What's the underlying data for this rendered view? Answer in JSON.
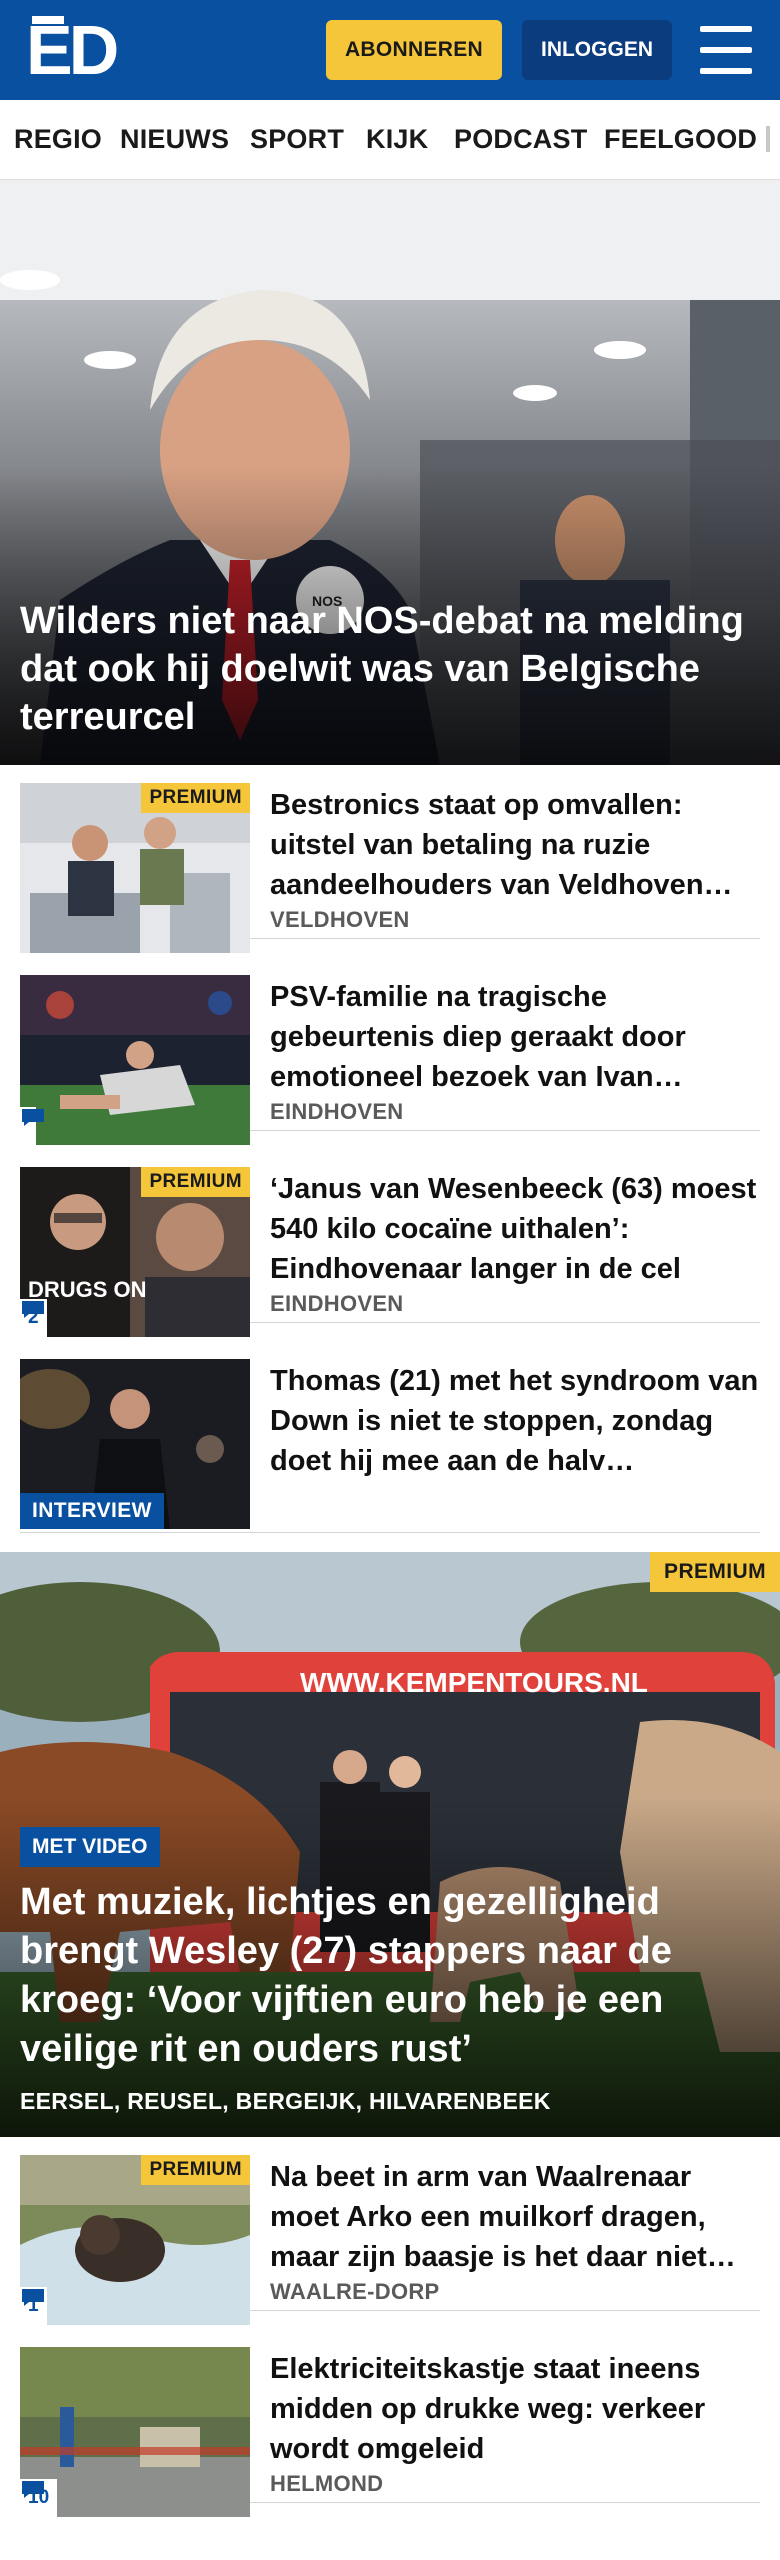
{
  "header": {
    "logo_text": "ED",
    "subscribe_label": "ABONNEREN",
    "login_label": "INLOGGEN",
    "menu_icon": "hamburger-menu-icon",
    "brand_color": "#0a50a0",
    "accent_color": "#f6c63a"
  },
  "nav": {
    "items": [
      "REGIO",
      "NIEUWS",
      "SPORT",
      "KIJK",
      "PODCAST",
      "FEELGOOD"
    ]
  },
  "hero": {
    "title": "Wilders niet naar NOS-debat na melding dat ook hij doelwit was van Belgische terreurcel"
  },
  "articles": [
    {
      "title": "Bestronics staat op omvallen: uitstel van betaling na ruzie aandeelhouders van Veldhoven…",
      "location": "VELDHOVEN",
      "badge": "PREMIUM"
    },
    {
      "title": "PSV-familie na tragische gebeurtenis diep geraakt door emotioneel bezoek van Ivan…",
      "location": "EINDHOVEN",
      "comment_count": ""
    },
    {
      "title": "‘Janus van Wesenbeeck (63) moest 540 kilo cocaïne uithalen’: Eindhovenaar langer in de cel",
      "location": "EINDHOVEN",
      "badge": "PREMIUM",
      "comment_count": "2",
      "thumb_text": "DRUGS ON"
    },
    {
      "title": "Thomas (21) met het syndroom van Down is niet te stoppen, zondag doet hij mee aan de halv…",
      "label": "INTERVIEW"
    }
  ],
  "feature": {
    "badge": "PREMIUM",
    "video_label": "MET VIDEO",
    "title": "Met muziek, lichtjes en gezelligheid brengt Wesley (27) stappers naar de kroeg: ‘Voor vijftien euro heb je een veilige rit en ouders rust’",
    "location": "EERSEL, REUSEL, BERGEIJK, HILVARENBEEK",
    "bus_text": "WWW.KEMPENTOURS.NL"
  },
  "articles2": [
    {
      "title": "Na beet in arm van Waalrenaar moet Arko een muilkorf dragen, maar zijn baasje is het daar niet…",
      "location": "WAALRE-DORP",
      "badge": "PREMIUM",
      "comment_count": "1"
    },
    {
      "title": "Elektriciteitskastje staat ineens midden op drukke weg: verkeer wordt omgeleid",
      "location": "HELMOND",
      "comment_count": "10"
    }
  ]
}
